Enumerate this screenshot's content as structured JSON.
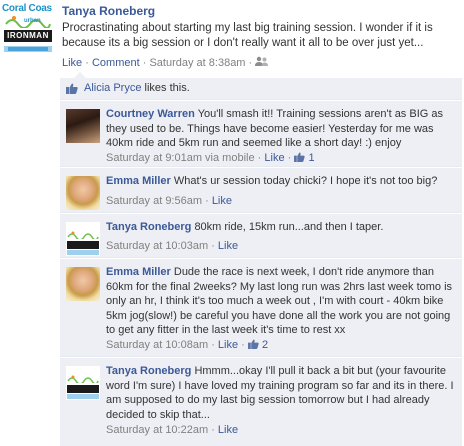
{
  "post": {
    "author": "Tanya Roneberg",
    "text": "Procrastinating about starting my last big training session. I wonder if it is because its a big session or I don't really want it all to be over just yet...",
    "actions": {
      "like": "Like",
      "comment": "Comment",
      "timestamp": "Saturday at 8:38am"
    },
    "avatar_logo": {
      "line1": "Coral Coas",
      "line3": "IRONMAN"
    }
  },
  "likes": {
    "name": "Alicia Pryce",
    "suffix": " likes this."
  },
  "comments": [
    {
      "author": "Courtney Warren",
      "text": "You'll smash it!! Training sessions aren't as BIG as they used to be. Things have become easier! Yesterday for me was 40km ride and 5km run and seemed like a short day! :) enjoy",
      "timestamp": "Saturday at 9:01am via mobile",
      "like": "Like",
      "like_count": "1"
    },
    {
      "author": "Emma Miller",
      "text": "What's ur session today chicki? I hope it's not too big?",
      "timestamp": "Saturday at 9:56am",
      "like": "Like"
    },
    {
      "author": "Tanya Roneberg",
      "text": "80km ride, 15km run...and then I taper.",
      "timestamp": "Saturday at 10:03am",
      "like": "Like"
    },
    {
      "author": "Emma Miller",
      "text": "Dude the race is next week, I don't ride anymore than 60km for the final 2weeks? My last long run was 2hrs last week tomo is only an hr, I think it's too much a week out , I'm with court - 40km bike 5km jog(slow!) be careful you have done all the work you are not going to get any fitter in the last week it's time to rest xx",
      "timestamp": "Saturday at 10:08am",
      "like": "Like",
      "like_count": "2"
    },
    {
      "author": "Tanya Roneberg",
      "text": "Hmmm...okay I'll pull it back a bit but (your favourite word I'm sure) I have loved my training program so far and its in there. I am supposed to do my last big session tomorrow but I had already decided to skip that...",
      "timestamp": "Saturday at 10:22am",
      "like": "Like"
    }
  ]
}
